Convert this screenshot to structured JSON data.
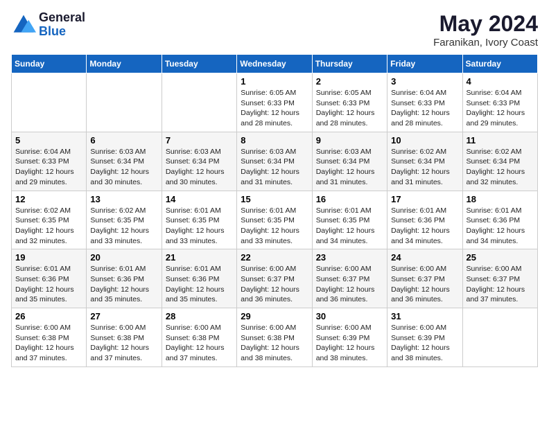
{
  "header": {
    "logo_general": "General",
    "logo_blue": "Blue",
    "month_year": "May 2024",
    "location": "Faranikan, Ivory Coast"
  },
  "weekdays": [
    "Sunday",
    "Monday",
    "Tuesday",
    "Wednesday",
    "Thursday",
    "Friday",
    "Saturday"
  ],
  "weeks": [
    [
      {
        "day": "",
        "info": ""
      },
      {
        "day": "",
        "info": ""
      },
      {
        "day": "",
        "info": ""
      },
      {
        "day": "1",
        "info": "Sunrise: 6:05 AM\nSunset: 6:33 PM\nDaylight: 12 hours\nand 28 minutes."
      },
      {
        "day": "2",
        "info": "Sunrise: 6:05 AM\nSunset: 6:33 PM\nDaylight: 12 hours\nand 28 minutes."
      },
      {
        "day": "3",
        "info": "Sunrise: 6:04 AM\nSunset: 6:33 PM\nDaylight: 12 hours\nand 28 minutes."
      },
      {
        "day": "4",
        "info": "Sunrise: 6:04 AM\nSunset: 6:33 PM\nDaylight: 12 hours\nand 29 minutes."
      }
    ],
    [
      {
        "day": "5",
        "info": "Sunrise: 6:04 AM\nSunset: 6:33 PM\nDaylight: 12 hours\nand 29 minutes."
      },
      {
        "day": "6",
        "info": "Sunrise: 6:03 AM\nSunset: 6:34 PM\nDaylight: 12 hours\nand 30 minutes."
      },
      {
        "day": "7",
        "info": "Sunrise: 6:03 AM\nSunset: 6:34 PM\nDaylight: 12 hours\nand 30 minutes."
      },
      {
        "day": "8",
        "info": "Sunrise: 6:03 AM\nSunset: 6:34 PM\nDaylight: 12 hours\nand 31 minutes."
      },
      {
        "day": "9",
        "info": "Sunrise: 6:03 AM\nSunset: 6:34 PM\nDaylight: 12 hours\nand 31 minutes."
      },
      {
        "day": "10",
        "info": "Sunrise: 6:02 AM\nSunset: 6:34 PM\nDaylight: 12 hours\nand 31 minutes."
      },
      {
        "day": "11",
        "info": "Sunrise: 6:02 AM\nSunset: 6:34 PM\nDaylight: 12 hours\nand 32 minutes."
      }
    ],
    [
      {
        "day": "12",
        "info": "Sunrise: 6:02 AM\nSunset: 6:35 PM\nDaylight: 12 hours\nand 32 minutes."
      },
      {
        "day": "13",
        "info": "Sunrise: 6:02 AM\nSunset: 6:35 PM\nDaylight: 12 hours\nand 33 minutes."
      },
      {
        "day": "14",
        "info": "Sunrise: 6:01 AM\nSunset: 6:35 PM\nDaylight: 12 hours\nand 33 minutes."
      },
      {
        "day": "15",
        "info": "Sunrise: 6:01 AM\nSunset: 6:35 PM\nDaylight: 12 hours\nand 33 minutes."
      },
      {
        "day": "16",
        "info": "Sunrise: 6:01 AM\nSunset: 6:35 PM\nDaylight: 12 hours\nand 34 minutes."
      },
      {
        "day": "17",
        "info": "Sunrise: 6:01 AM\nSunset: 6:36 PM\nDaylight: 12 hours\nand 34 minutes."
      },
      {
        "day": "18",
        "info": "Sunrise: 6:01 AM\nSunset: 6:36 PM\nDaylight: 12 hours\nand 34 minutes."
      }
    ],
    [
      {
        "day": "19",
        "info": "Sunrise: 6:01 AM\nSunset: 6:36 PM\nDaylight: 12 hours\nand 35 minutes."
      },
      {
        "day": "20",
        "info": "Sunrise: 6:01 AM\nSunset: 6:36 PM\nDaylight: 12 hours\nand 35 minutes."
      },
      {
        "day": "21",
        "info": "Sunrise: 6:01 AM\nSunset: 6:36 PM\nDaylight: 12 hours\nand 35 minutes."
      },
      {
        "day": "22",
        "info": "Sunrise: 6:00 AM\nSunset: 6:37 PM\nDaylight: 12 hours\nand 36 minutes."
      },
      {
        "day": "23",
        "info": "Sunrise: 6:00 AM\nSunset: 6:37 PM\nDaylight: 12 hours\nand 36 minutes."
      },
      {
        "day": "24",
        "info": "Sunrise: 6:00 AM\nSunset: 6:37 PM\nDaylight: 12 hours\nand 36 minutes."
      },
      {
        "day": "25",
        "info": "Sunrise: 6:00 AM\nSunset: 6:37 PM\nDaylight: 12 hours\nand 37 minutes."
      }
    ],
    [
      {
        "day": "26",
        "info": "Sunrise: 6:00 AM\nSunset: 6:38 PM\nDaylight: 12 hours\nand 37 minutes."
      },
      {
        "day": "27",
        "info": "Sunrise: 6:00 AM\nSunset: 6:38 PM\nDaylight: 12 hours\nand 37 minutes."
      },
      {
        "day": "28",
        "info": "Sunrise: 6:00 AM\nSunset: 6:38 PM\nDaylight: 12 hours\nand 37 minutes."
      },
      {
        "day": "29",
        "info": "Sunrise: 6:00 AM\nSunset: 6:38 PM\nDaylight: 12 hours\nand 38 minutes."
      },
      {
        "day": "30",
        "info": "Sunrise: 6:00 AM\nSunset: 6:39 PM\nDaylight: 12 hours\nand 38 minutes."
      },
      {
        "day": "31",
        "info": "Sunrise: 6:00 AM\nSunset: 6:39 PM\nDaylight: 12 hours\nand 38 minutes."
      },
      {
        "day": "",
        "info": ""
      }
    ]
  ]
}
